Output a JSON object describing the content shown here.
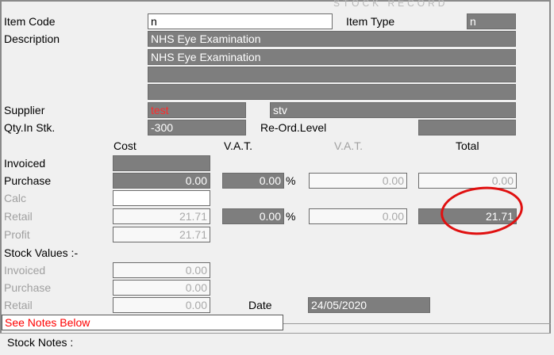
{
  "window": {
    "title_ghost": "STOCK RECORD"
  },
  "labels": {
    "item_code": "Item Code",
    "item_type": "Item Type",
    "description": "Description",
    "supplier": "Supplier",
    "qty_in_stock": "Qty.In Stk.",
    "reorder_level": "Re-Ord.Level",
    "invoiced": "Invoiced",
    "purchase": "Purchase",
    "calc": "Calc",
    "retail": "Retail",
    "profit": "Profit",
    "stock_values": "Stock Values :-",
    "sv_invoiced": "Invoiced",
    "sv_purchase": "Purchase",
    "sv_retail": "Retail",
    "date": "Date",
    "see_notes": "See Notes Below",
    "stock_notes": "Stock Notes :",
    "pct": "%"
  },
  "headers": {
    "cost": "Cost",
    "vat": "V.A.T.",
    "vat2": "V.A.T.",
    "total": "Total"
  },
  "fields": {
    "item_code": "n",
    "item_type": "n",
    "description_lines": [
      "NHS Eye Examination",
      "NHS Eye Examination",
      "",
      ""
    ],
    "supplier_code": "test",
    "supplier_name": "stv",
    "qty_in_stock": "-300",
    "reorder_level": "",
    "invoiced_cost": "",
    "purchase_cost": "0.00",
    "purchase_vat_pct": "0.00",
    "purchase_vat": "0.00",
    "purchase_total": "0.00",
    "calc_cost": "",
    "retail_cost": "21.71",
    "retail_vat_pct": "0.00",
    "retail_vat": "0.00",
    "retail_total": "21.71",
    "profit": "21.71",
    "sv_invoiced": "0.00",
    "sv_purchase": "0.00",
    "sv_retail": "0.00",
    "date": "24/05/2020"
  },
  "annotation": {
    "color": "#e01010"
  }
}
